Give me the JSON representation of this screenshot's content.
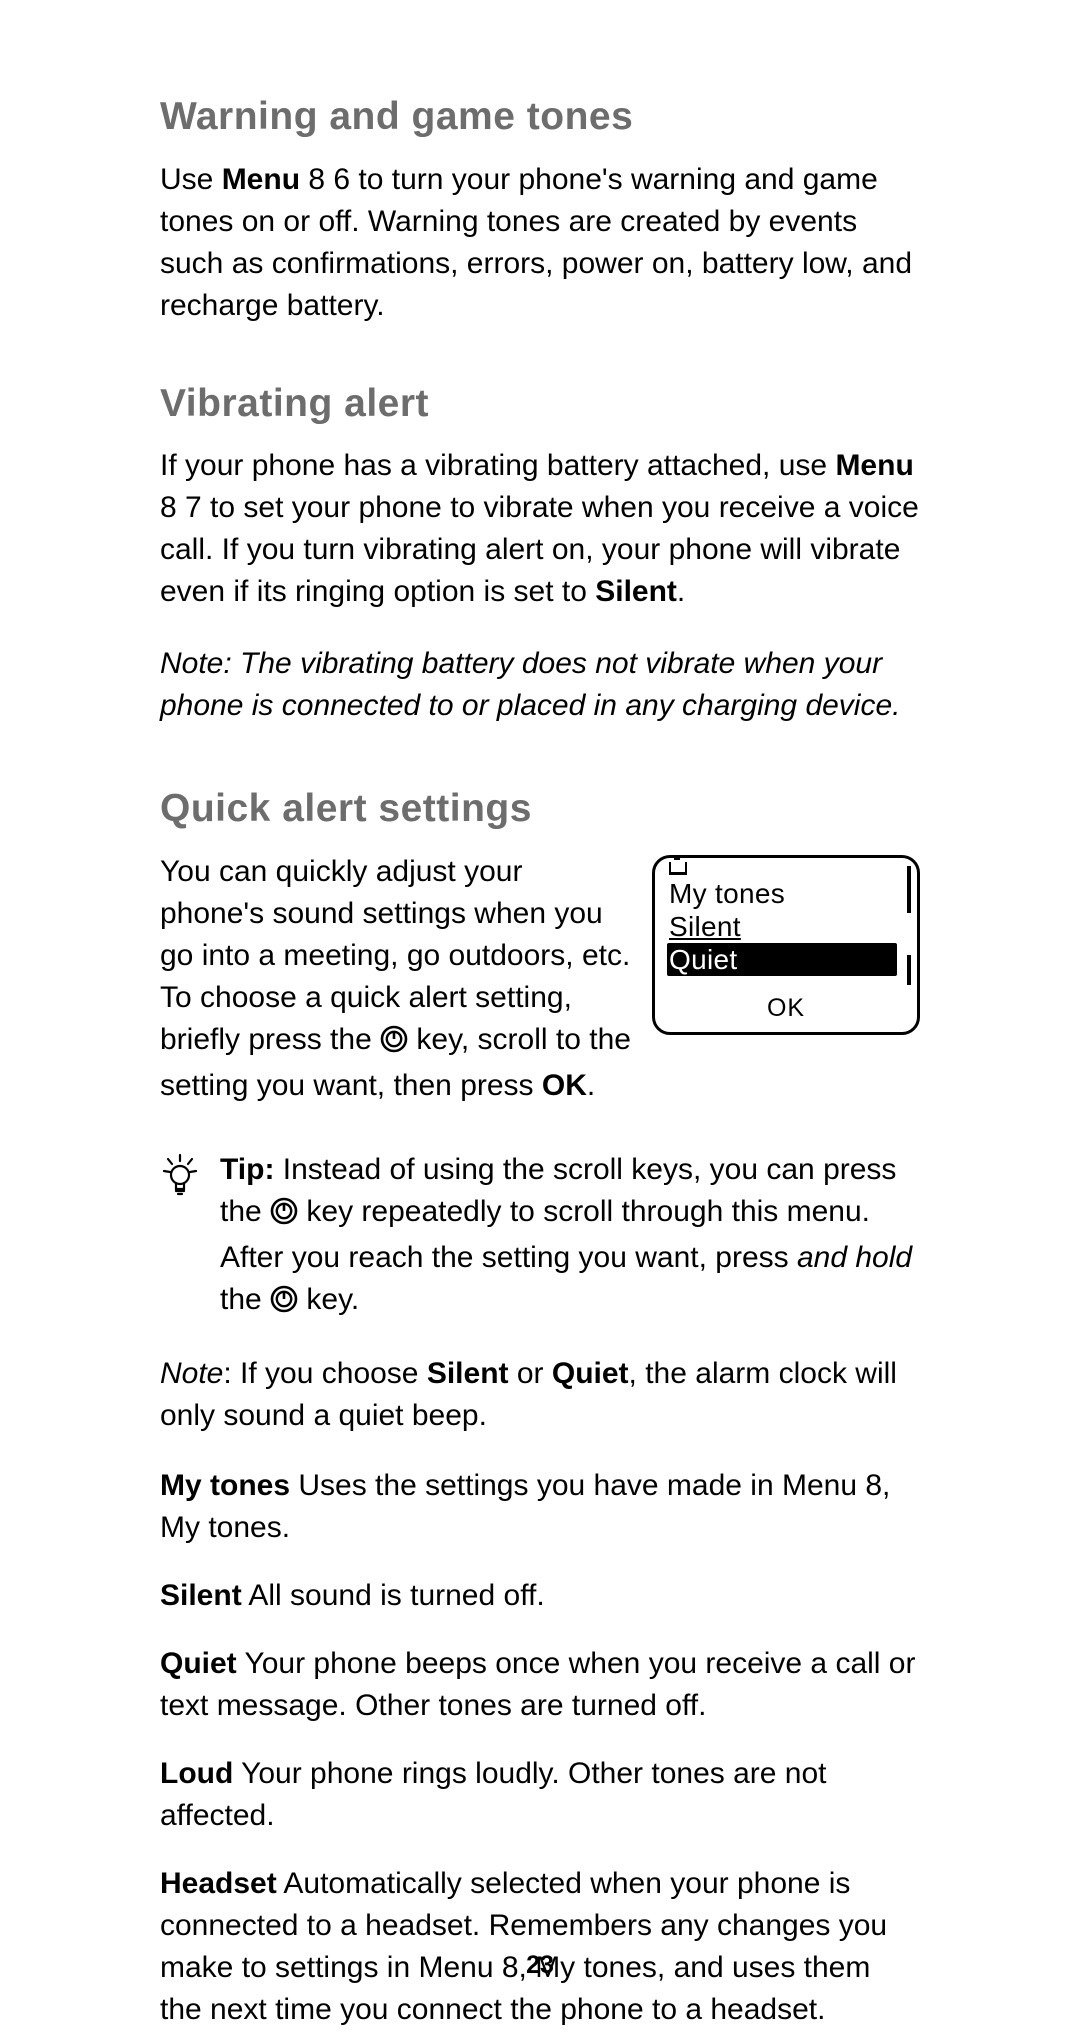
{
  "page_number": "23",
  "sections": {
    "warning": {
      "title": "Warning and game tones",
      "body_pre": "Use ",
      "body_menu": "Menu",
      "body_post": " 8 6 to turn your phone's warning and game tones on or off. Warning tones are created by events such as  con­firmations, errors, power on, battery low, and recharge battery."
    },
    "vibrate": {
      "title": "Vibrating alert",
      "body_pre": "If your phone has a vibrating battery attached, use ",
      "body_menu": "Menu",
      "body_mid": " 8 7 to set your phone to vibrate when you receive a voice call. If you turn vibrating alert on, your phone will vibrate even if its ringing option is set to ",
      "body_silent": "Silent",
      "body_post": ".",
      "note": "Note:  The vibrating battery does not vibrate when your phone is connected to or placed in any charging device."
    },
    "quick": {
      "title": "Quick alert settings",
      "body_pre": "You can quickly adjust your phone's sound settings when you go into a meeting, go outdoors, etc. To choose a quick alert setting, briefly press the ",
      "body_mid": " key, scroll to the setting you want, then press ",
      "body_ok": "OK",
      "body_post": ".",
      "phone": {
        "line1": "My tones",
        "line2": "Silent",
        "line3_selected": "Quiet",
        "softkey": "OK"
      },
      "tip_label": "Tip:",
      "tip_pre": "  Instead of using the scroll keys, you can press the ",
      "tip_mid": " key repeatedly to scroll through this menu. After you reach the setting you want, press ",
      "tip_hold": "and hold",
      "tip_mid2": " the ",
      "tip_post": " key.",
      "note2_label": "Note",
      "note2_pre": ":  If you choose ",
      "note2_silent": "Silent",
      "note2_or": " or ",
      "note2_quiet": "Quiet",
      "note2_post": ", the alarm clock will only sound a quiet beep."
    },
    "defs": {
      "mytones_label": "My tones",
      "mytones_body": "  Uses the settings you have made in Menu 8, My tones.",
      "silent_label": "Silent",
      "silent_body": "  All sound is turned off.",
      "quiet_label": "Quiet",
      "quiet_body": "  Your phone beeps once when you receive a call or text message. Other tones are turned off.",
      "loud_label": "Loud",
      "loud_body": "  Your phone rings loudly. Other tones are not affected.",
      "headset_label": "Headset",
      "headset_body": "  Automatically selected when your phone is connected to a headset. Remembers any changes you make to settings in Menu 8, My tones, and uses them the next time you connect the phone to a headset."
    }
  }
}
